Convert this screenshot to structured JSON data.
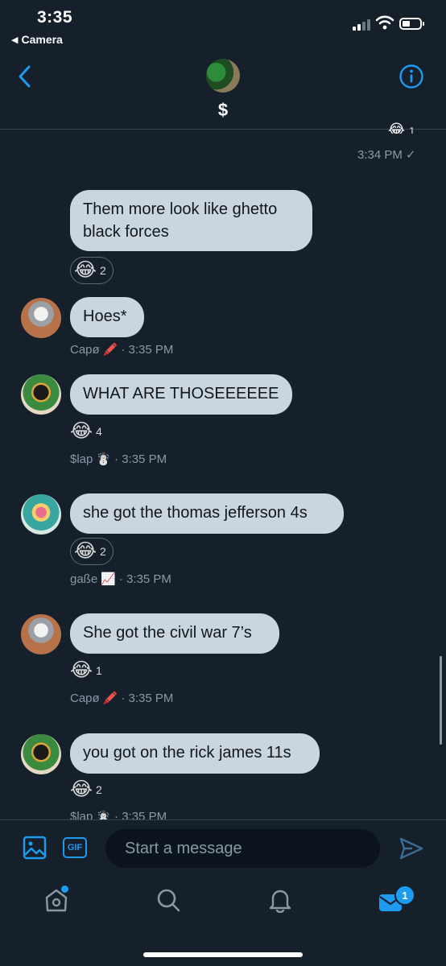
{
  "status": {
    "time": "3:35",
    "back_app": "Camera"
  },
  "header": {
    "title": "$"
  },
  "prev_message": {
    "time": "3:34 PM",
    "check": "✓",
    "partial_reaction": "1"
  },
  "messages": [
    {
      "text": "Them more look like ghetto black forces",
      "reaction_emoji": "😂",
      "reaction_count": "2",
      "sender": "",
      "sender_emoji": "",
      "time": ""
    },
    {
      "text": "Hoes*",
      "reaction_emoji": "",
      "reaction_count": "",
      "sender": "Capø",
      "sender_emoji": "🖍️",
      "time": "· 3:35 PM"
    },
    {
      "text": "WHAT ARE THOSEEEEEE",
      "reaction_emoji": "😂",
      "reaction_count": "4",
      "sender": "$lap",
      "sender_emoji": "☃️",
      "time": "· 3:35 PM"
    },
    {
      "text": "she got the thomas jefferson 4s",
      "reaction_emoji": "😂",
      "reaction_count": "2",
      "sender": "gaße",
      "sender_emoji": "📈",
      "time": "· 3:35 PM"
    },
    {
      "text": "She got the civil war 7’s",
      "reaction_emoji": "😂",
      "reaction_count": "1",
      "sender": "Capø",
      "sender_emoji": "🖍️",
      "time": "· 3:35 PM"
    },
    {
      "text": "you got on the rick james 11s",
      "reaction_emoji": "😂",
      "reaction_count": "2",
      "sender": "$lap",
      "sender_emoji": "☃️",
      "time": "· 3:35 PM"
    }
  ],
  "composer": {
    "placeholder": "Start a message",
    "gif_label": "GIF"
  },
  "tabbar": {
    "messages_badge": "1"
  },
  "colors": {
    "background": "#15202b",
    "accent": "#1d9bf0",
    "bubble": "#c9d6df"
  }
}
